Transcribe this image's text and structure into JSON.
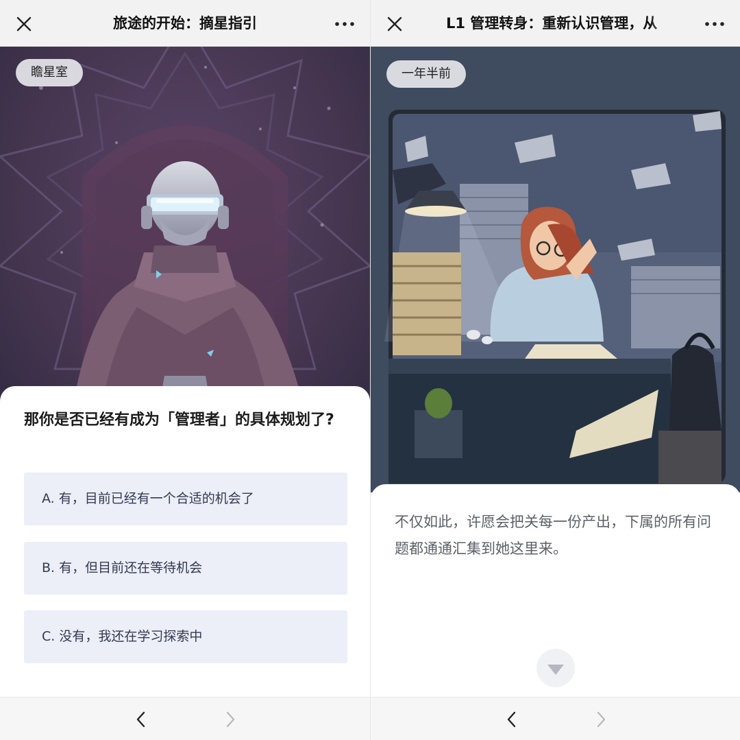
{
  "left": {
    "title": "旅途的开始：摘星指引",
    "scene_tag": "瞻星室",
    "question": "那你是否已经有成为「管理者」的具体规划了?",
    "options": [
      "A. 有，目前已经有一个合适的机会了",
      "B. 有，但目前还在等待机会",
      "C. 没有，我还在学习探索中"
    ],
    "icons": {
      "close": "close-icon",
      "more": "more-icon",
      "prev": "chevron-left-icon",
      "next": "chevron-right-icon"
    }
  },
  "right": {
    "title": "L1 管理转身：重新认识管理，从",
    "scene_tag": "一年半前",
    "narration": "不仅如此，许愿会把关每一份产出，下属的所有问题都通通汇集到她这里来。",
    "icons": {
      "close": "close-icon",
      "more": "more-icon",
      "continue": "triangle-down-icon",
      "prev": "chevron-left-icon",
      "next": "chevron-right-icon"
    }
  },
  "colors": {
    "option_bg": "#eceef8",
    "nav_active": "#222222",
    "nav_disabled": "#b8b8b8",
    "left_scene_bg": "#4d3a5c",
    "right_scene_bg": "#3f4b5e"
  }
}
